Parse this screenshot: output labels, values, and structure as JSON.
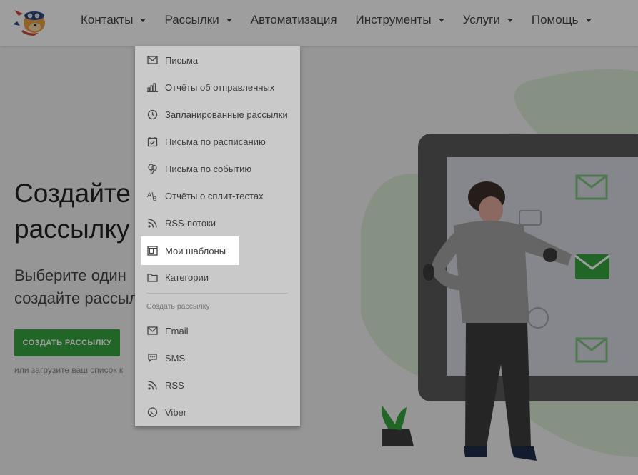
{
  "nav": {
    "items": [
      {
        "label": "Контакты",
        "has_caret": true
      },
      {
        "label": "Рассылки",
        "has_caret": true
      },
      {
        "label": "Автоматизация",
        "has_caret": false
      },
      {
        "label": "Инструменты",
        "has_caret": true
      },
      {
        "label": "Услуги",
        "has_caret": true
      },
      {
        "label": "Помощь",
        "has_caret": true
      }
    ]
  },
  "hero": {
    "title_line1": "Создайте п",
    "title_line2": "рассылку",
    "subtitle_line1": "Выберите один",
    "subtitle_line2": "создайте рассыл",
    "cta_label": "СОЗДАТЬ РАССЫЛКУ",
    "upload_prefix": "или",
    "upload_link": "загрузите ваш список к"
  },
  "dropdown": {
    "items": [
      {
        "label": "Письма",
        "icon": "envelope-icon"
      },
      {
        "label": "Отчёты об отправленных",
        "icon": "bar-chart-icon"
      },
      {
        "label": "Запланированные рассылки",
        "icon": "clock-icon"
      },
      {
        "label": "Письма по расписанию",
        "icon": "calendar-check-icon"
      },
      {
        "label": "Письма по событию",
        "icon": "balloons-icon"
      },
      {
        "label": "Отчёты о сплит-тестах",
        "icon": "ab-split-icon"
      },
      {
        "label": "RSS-потоки",
        "icon": "rss-icon"
      },
      {
        "label": "Мои шаблоны",
        "icon": "template-icon",
        "active": true
      },
      {
        "label": "Категории",
        "icon": "folder-icon"
      }
    ],
    "section_header": "Создать рассылку",
    "create_items": [
      {
        "label": "Email",
        "icon": "envelope-icon"
      },
      {
        "label": "SMS",
        "icon": "sms-icon"
      },
      {
        "label": "RSS",
        "icon": "rss-icon"
      },
      {
        "label": "Viber",
        "icon": "viber-icon"
      }
    ]
  },
  "colors": {
    "accent_green": "#36a540",
    "overlay": "rgba(0,0,0,0.38)",
    "dropdown_bg": "#c9c9c9"
  }
}
